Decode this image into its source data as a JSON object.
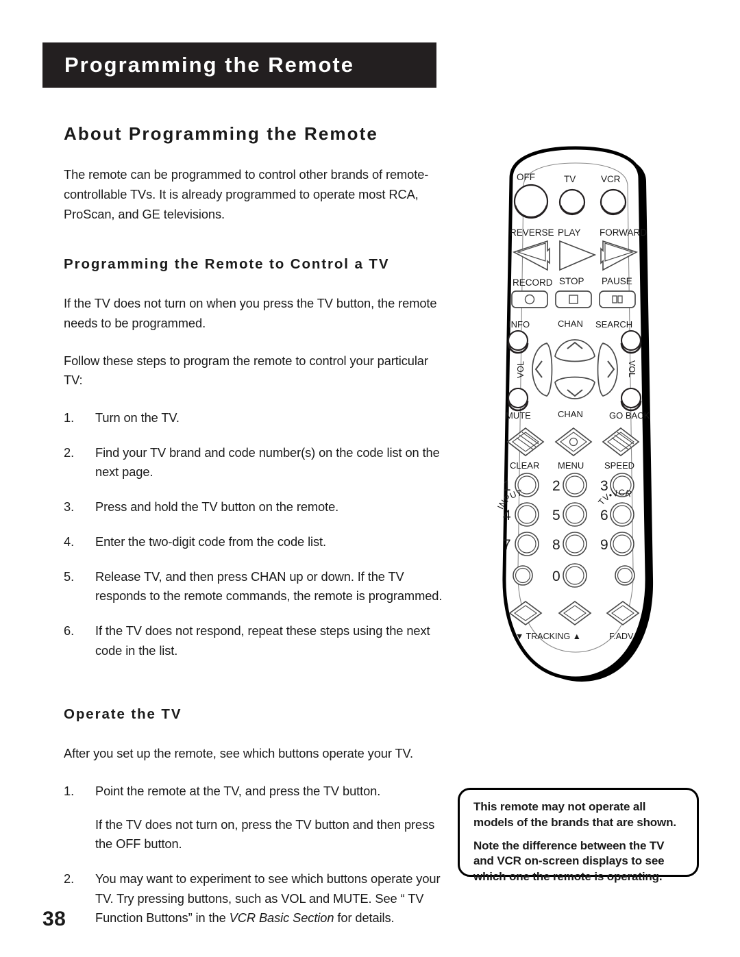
{
  "banner": {
    "title": "Programming the Remote"
  },
  "section": {
    "title": "About Programming the Remote",
    "intro": "The remote can be programmed to control other brands of remote-controllable TVs. It is already programmed to operate most RCA, ProScan, and GE televisions."
  },
  "subsection_control": {
    "title": "Programming the Remote to Control a TV",
    "para1": "If the TV does not turn on when you press the TV button, the remote needs to be programmed.",
    "para2": "Follow these steps to program the remote to control your particular TV:",
    "steps": [
      {
        "num": "1.",
        "text": "Turn on the TV."
      },
      {
        "num": "2.",
        "text": "Find your TV brand and code number(s) on the code list on the next page."
      },
      {
        "num": "3.",
        "text": "Press and hold the TV button on the remote."
      },
      {
        "num": "4.",
        "text": "Enter the two-digit code from the code list."
      },
      {
        "num": "5.",
        "text": "Release TV, and then press CHAN up or down. If the TV responds to the remote commands, the remote is programmed."
      },
      {
        "num": "6.",
        "text": "If the TV does not respond, repeat these steps using the next code in the list."
      }
    ]
  },
  "subsection_operate": {
    "title": "Operate the TV",
    "para1": "After you set up the remote, see which buttons operate your TV.",
    "step1_num": "1.",
    "step1_text": "Point the remote at the TV, and press the TV button.",
    "step1_sub": "If the TV does not turn on, press the TV button and then press the OFF button.",
    "step2_num": "2.",
    "step2_text_a": "You may want to experiment to see which buttons operate your TV. Try pressing buttons, such as VOL and MUTE. See “ TV Function Buttons” in the ",
    "step2_italic": "VCR Basic Section",
    "step2_text_b": " for details."
  },
  "note_box": {
    "para1": "This remote may not operate all models of the brands that are shown.",
    "para2": "Note the difference between the TV and  VCR on-screen displays to see which one the remote is operating."
  },
  "page_number": "38",
  "remote": {
    "row_power": [
      "OFF",
      "TV",
      "VCR"
    ],
    "row_transport1": [
      "REVERSE",
      "PLAY",
      "FORWARD"
    ],
    "row_transport2": [
      "RECORD",
      "STOP",
      "PAUSE"
    ],
    "dpad": {
      "info": "INFO",
      "search": "SEARCH",
      "mute": "MUTE",
      "go_back": "GO BACK",
      "chan_up": "CHAN",
      "chan_down": "CHAN",
      "vol_left": "VOL",
      "vol_right": "VOL"
    },
    "row_diamond": [
      "CLEAR",
      "MENU",
      "SPEED"
    ],
    "keypad": [
      "1",
      "2",
      "3",
      "4",
      "5",
      "6",
      "7",
      "8",
      "9"
    ],
    "row_zero": {
      "input": "INPUT",
      "zero": "0",
      "tv_vcr": "TV•VCR"
    },
    "row_bottom": {
      "tracking": "▼ TRACKING ▲",
      "f_adv": "F.ADV"
    }
  },
  "colors": {
    "banner_bg": "#231f20",
    "text": "#1a1a1a",
    "line": "#231f20"
  }
}
